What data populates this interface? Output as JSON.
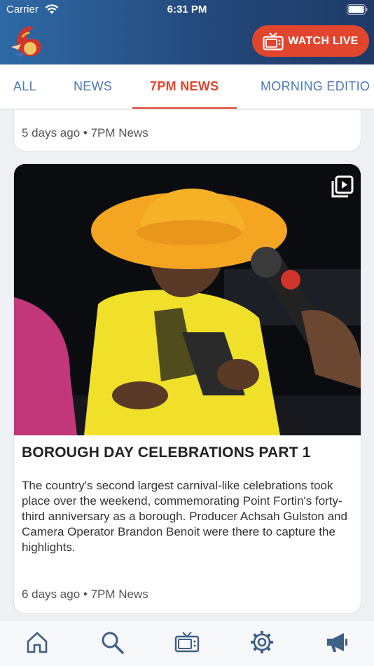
{
  "status_bar": {
    "carrier": "Carrier",
    "time": "6:31 PM"
  },
  "header": {
    "watch_live_label": "WATCH LIVE",
    "logo_icon": "tv6-logo",
    "watch_live_icon": "tv-icon"
  },
  "tabs": [
    {
      "label": "ALL",
      "active": false
    },
    {
      "label": "NEWS",
      "active": false
    },
    {
      "label": "7PM NEWS",
      "active": true
    },
    {
      "label": "MORNING EDITIO",
      "active": false
    }
  ],
  "feed": {
    "previous_card": {
      "meta": "5 days ago • 7PM News"
    },
    "card": {
      "title": "BOROUGH DAY CELEBRATIONS PART 1",
      "description": "The country's second largest carnival-like celebrations took place over the weekend, commemorating Point Fortin's forty-third anniversary as a borough. Producer Achsah Gulston and Camera Operator Brandon Benoit were there to capture the highlights.",
      "meta": "6 days ago • 7PM News",
      "media_icon": "video-playlist-icon"
    }
  },
  "bottom_nav": [
    {
      "icon": "home-icon"
    },
    {
      "icon": "search-icon"
    },
    {
      "icon": "tv-icon"
    },
    {
      "icon": "settings-icon"
    },
    {
      "icon": "megaphone-icon"
    }
  ],
  "colors": {
    "accent": "#e1452d",
    "tab_text": "#4b7bb7",
    "header_start": "#2f6aa6",
    "header_end": "#1f3a66"
  }
}
